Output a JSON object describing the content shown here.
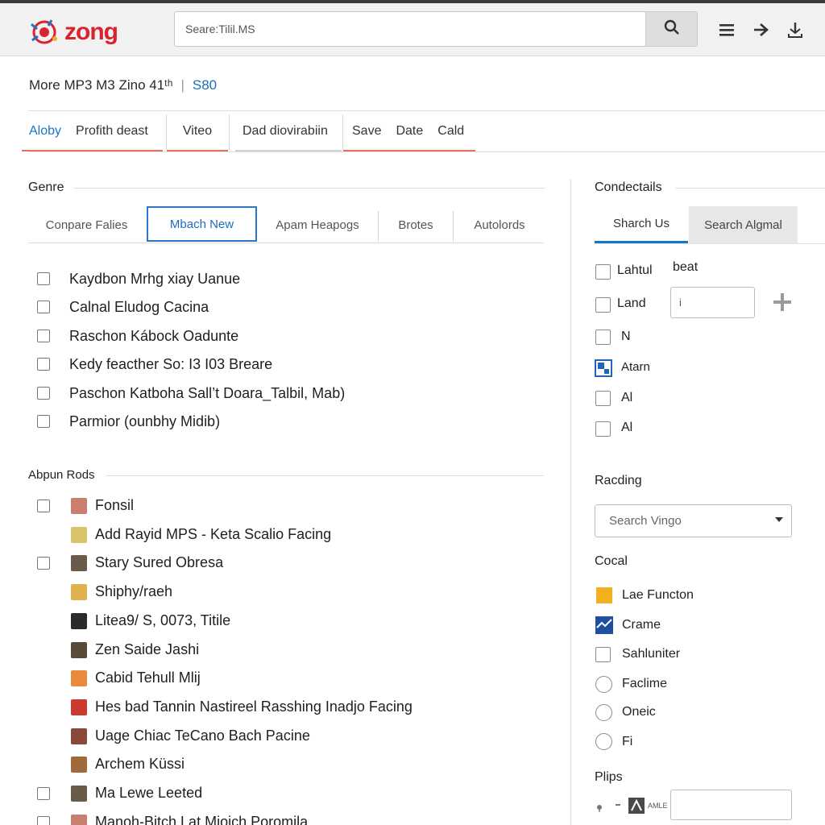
{
  "header": {
    "logo_text": "zong",
    "search_placeholder": "Seare:Tilil.MS",
    "icons": [
      "search-icon",
      "menu-icon",
      "forward-arrow-icon",
      "download-icon"
    ]
  },
  "page": {
    "title": "More MP3 M3 Zino 41ᵗʰ",
    "separator": "|",
    "count": "S80"
  },
  "primary_tabs": [
    {
      "label": "Aloby",
      "active": true
    },
    {
      "label": "Profith deast",
      "active": false
    },
    {
      "label": "Viteo",
      "active": false
    },
    {
      "label": "Dad diovirabiin",
      "active": false
    },
    {
      "label": "Save",
      "active": false
    },
    {
      "label": "Date",
      "active": false
    },
    {
      "label": "Cald",
      "active": false
    }
  ],
  "genre": {
    "heading": "Genre",
    "tabs": [
      {
        "label": "Conpare Falies",
        "active": false
      },
      {
        "label": "Mbach New",
        "active": true
      },
      {
        "label": "Apam Heapogs",
        "active": false
      },
      {
        "label": "Brotes",
        "active": false
      },
      {
        "label": "Autolords",
        "active": false
      }
    ],
    "items": [
      {
        "label": "Kaydbon Mrhg xiay Uanue",
        "checked": false
      },
      {
        "label": "Calnal Eludog Cacina",
        "checked": false
      },
      {
        "label": "Raschon Kábock Oadunte",
        "checked": false
      },
      {
        "label": "Kedy feacther So: I3 I03 Breare",
        "checked": false
      },
      {
        "label": "Paschon Katboha Sall’t Doara_Talbil, Mab)",
        "checked": false
      },
      {
        "label": "Parmior (ounbhy Midib)",
        "checked": false
      }
    ]
  },
  "album": {
    "heading": "Abpun Rods",
    "items": [
      {
        "label": "Fonsil",
        "checkbox": true,
        "thumb_color": "#c97f6d"
      },
      {
        "label": "Add Rayid MPS - Keta Scalio Facing",
        "checkbox": false,
        "thumb_color": "#d9c36a"
      },
      {
        "label": "Stary Sured Obresa",
        "checkbox": true,
        "thumb_color": "#6b5a4a"
      },
      {
        "label": "Shiphy/raeh",
        "checkbox": false,
        "thumb_color": "#e0b24f"
      },
      {
        "label": "Litea9/ S, 0073, Titile",
        "checkbox": false,
        "thumb_color": "#2b2b2b"
      },
      {
        "label": "Zen Saide Jashi",
        "checkbox": false,
        "thumb_color": "#5a4a3a"
      },
      {
        "label": "Cabid Tehull Mlij",
        "checkbox": false,
        "thumb_color": "#e88a3c"
      },
      {
        "label": "Hes bad Tannin Nastireel Rasshing Inadjo Facing",
        "checkbox": false,
        "thumb_color": "#c93a2f"
      },
      {
        "label": "Uage Chiac TeCano Bach Pacine",
        "checkbox": false,
        "thumb_color": "#8a4a3a"
      },
      {
        "label": "Archem Küssi",
        "checkbox": false,
        "thumb_color": "#a06a3a"
      },
      {
        "label": "Ma Lewe Leeted",
        "checkbox": true,
        "thumb_color": "#6a5a4a"
      },
      {
        "label": "Manoh-Bitch Lat Miojch Poromila",
        "checkbox": true,
        "thumb_color": "#c97f6d"
      }
    ]
  },
  "right": {
    "heading": "Condectails",
    "tabs": [
      {
        "label": "Sharch Us",
        "active": true
      },
      {
        "label": "Search Algmal",
        "active": false
      }
    ],
    "filters": [
      {
        "label": "Lahtul",
        "checked": false
      },
      {
        "label": "Land",
        "checked": false
      },
      {
        "label": "N",
        "checked": false
      },
      {
        "label": "Atarn",
        "checked": true
      },
      {
        "label": "Al",
        "checked": false
      },
      {
        "label": "Al",
        "checked": false
      }
    ],
    "side_label": "beat",
    "side_input_value": "i",
    "racing": {
      "heading": "Racding",
      "select_value": "Search Vingo"
    },
    "cocal": {
      "heading": "Cocal",
      "items": [
        {
          "label": "Lae Functon",
          "kind": "swatch",
          "color": "#f2b01e"
        },
        {
          "label": "Crame",
          "kind": "swatch",
          "color": "#1f4fa0"
        },
        {
          "label": "Sahluniter",
          "kind": "checkbox"
        },
        {
          "label": "Faclime",
          "kind": "radio"
        },
        {
          "label": "Oneic",
          "kind": "radio"
        },
        {
          "label": "Fi",
          "kind": "radio"
        }
      ]
    },
    "plips": {
      "heading": "Plips",
      "small_label": "AMLE",
      "input_value": ""
    }
  },
  "colors": {
    "accent_blue": "#1a74c7",
    "brand_red": "#d9232d",
    "tab_underline_red": "#e27163"
  }
}
